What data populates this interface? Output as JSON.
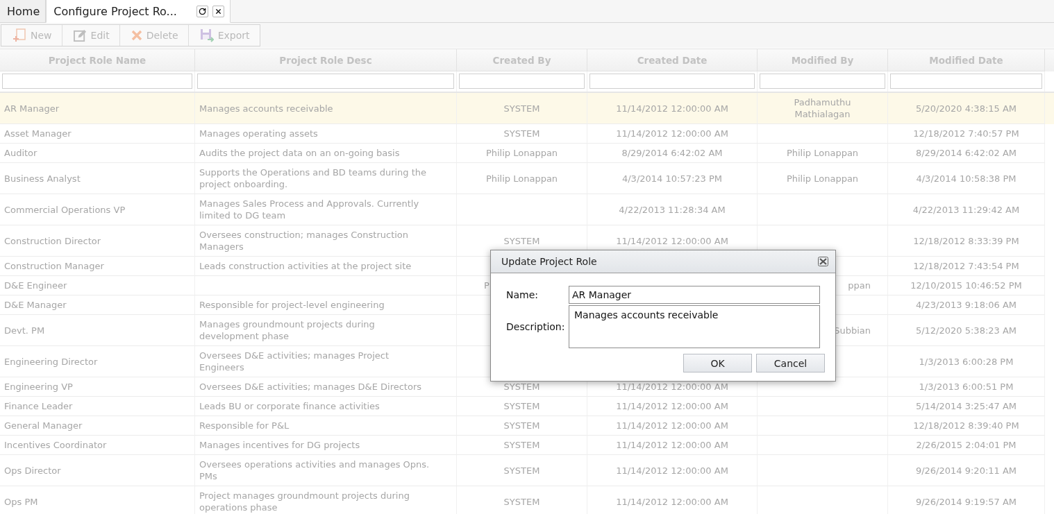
{
  "tabs": [
    {
      "label": "Home",
      "selected": false,
      "closable": false
    },
    {
      "label": "Configure Project Ro...",
      "selected": true,
      "closable": true
    }
  ],
  "toolbar": [
    {
      "kind": "new",
      "label": "New",
      "disabled": true
    },
    {
      "kind": "edit",
      "label": "Edit",
      "disabled": true
    },
    {
      "kind": "delete",
      "label": "Delete",
      "disabled": true
    },
    {
      "kind": "export",
      "label": "Export",
      "disabled": true
    }
  ],
  "table": {
    "columns": [
      "Project Role Name",
      "Project Role Desc",
      "Created By",
      "Created Date",
      "Modified By",
      "Modified Date"
    ],
    "rows": [
      {
        "selected": true,
        "cells": [
          "AR Manager",
          "Manages accounts receivable",
          "SYSTEM",
          "11/14/2012 12:00:00 AM",
          "Padhamuthu\nMathialagan",
          "5/20/2020 4:38:15 AM"
        ]
      },
      {
        "selected": false,
        "cells": [
          "Asset Manager",
          "Manages operating assets",
          "SYSTEM",
          "11/14/2012 12:00:00 AM",
          null,
          "12/18/2012 7:40:57 PM"
        ]
      },
      {
        "selected": false,
        "cells": [
          "Auditor",
          "Audits the project data on an on-going basis",
          "Philip Lonappan",
          "8/29/2014 6:42:02 AM",
          "Philip Lonappan",
          "8/29/2014 6:42:02 AM"
        ]
      },
      {
        "selected": false,
        "cells": [
          "Business Analyst",
          "Supports the Operations and BD teams during the\nproject onboarding.",
          "Philip Lonappan",
          "4/3/2014 10:57:23 PM",
          "Philip Lonappan",
          "4/3/2014 10:58:38 PM"
        ]
      },
      {
        "selected": false,
        "cells": [
          "Commercial Operations VP",
          "Manages Sales Process and Approvals. Currently\nlimited to DG team",
          null,
          "4/22/2013 11:28:34 AM",
          null,
          "4/22/2013 11:29:42 AM"
        ]
      },
      {
        "selected": false,
        "cells": [
          "Construction Director",
          "Oversees construction; manages Construction\nManagers",
          "SYSTEM",
          "11/14/2012 12:00:00 AM",
          null,
          "12/18/2012 8:33:39 PM"
        ]
      },
      {
        "selected": false,
        "cells": [
          "Construction Manager",
          "Leads construction activities at the project site",
          null,
          null,
          null,
          "12/18/2012 7:43:54 PM"
        ]
      },
      {
        "selected": false,
        "cells": [
          "D&E Engineer",
          null,
          {
            "kind": "clipped_end",
            "text": "P"
          },
          null,
          {
            "kind": "clipped_start",
            "text": "ppan"
          },
          "12/10/2015 10:46:52 PM"
        ]
      },
      {
        "selected": false,
        "cells": [
          "D&E Manager",
          "Responsible for project-level engineering",
          null,
          null,
          null,
          "4/23/2013 9:18:06 AM"
        ]
      },
      {
        "selected": false,
        "cells": [
          "Devt. PM",
          "Manages groundmount projects during\ndevelopment phase",
          null,
          null,
          {
            "kind": "clipped_start",
            "text": "Subbian"
          },
          "5/12/2020 5:38:23 AM"
        ]
      },
      {
        "selected": false,
        "cells": [
          "Engineering Director",
          "Oversees D&E activities; manages Project\nEngineers",
          null,
          null,
          null,
          "1/3/2013 6:00:28 PM"
        ]
      },
      {
        "selected": false,
        "cells": [
          "Engineering VP",
          "Oversees D&E activities; manages D&E Directors",
          "SYSTEM",
          "11/14/2012 12:00:00 AM",
          null,
          "1/3/2013 6:00:51 PM"
        ]
      },
      {
        "selected": false,
        "cells": [
          "Finance Leader",
          "Leads BU or corporate finance activities",
          "SYSTEM",
          "11/14/2012 12:00:00 AM",
          null,
          "5/14/2014 3:25:47 AM"
        ]
      },
      {
        "selected": false,
        "cells": [
          "General Manager",
          "Responsible for P&L",
          "SYSTEM",
          "11/14/2012 12:00:00 AM",
          null,
          "12/18/2012 8:39:40 PM"
        ]
      },
      {
        "selected": false,
        "cells": [
          "Incentives Coordinator",
          "Manages incentives for DG projects",
          "SYSTEM",
          "11/14/2012 12:00:00 AM",
          null,
          "2/26/2015 2:04:01 PM"
        ]
      },
      {
        "selected": false,
        "cells": [
          "Ops Director",
          "Oversees operations activities and manages Opns.\nPMs",
          "SYSTEM",
          "11/14/2012 12:00:00 AM",
          null,
          "9/26/2014 9:20:11 AM"
        ]
      },
      {
        "selected": false,
        "cells": [
          "Ops PM",
          "Project manages groundmount projects during\noperations phase",
          "SYSTEM",
          "11/14/2012 12:00:00 AM",
          null,
          "9/26/2014 9:19:57 AM"
        ]
      }
    ]
  },
  "dialog": {
    "title": "Update Project Role",
    "fields": [
      {
        "kind": "text",
        "label": "Name:",
        "value": "AR Manager"
      },
      {
        "kind": "textarea",
        "label": "Description:",
        "value": "Manages accounts receivable"
      }
    ],
    "buttons": [
      "OK",
      "Cancel"
    ]
  }
}
